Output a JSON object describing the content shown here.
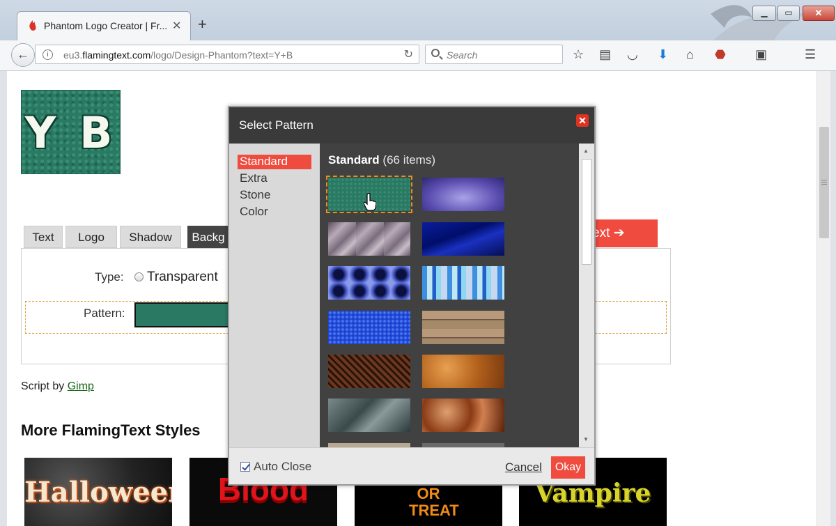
{
  "browser": {
    "tab_title": "Phantom Logo Creator | Fr...",
    "tab_close": "✕",
    "new_tab": "+",
    "url_prefix": "eu3.",
    "url_domain": "flamingtext.com",
    "url_path": "/logo/Design-Phantom?text=Y+B",
    "search_placeholder": "Search"
  },
  "page": {
    "logo_text": "Y B",
    "tabs": [
      "Text",
      "Logo",
      "Shadow",
      "Backg"
    ],
    "next_label": "ext ➔",
    "type_label": "Type:",
    "type_option": "Transparent",
    "pattern_label": "Pattern:",
    "script_by": "Script by",
    "script_by_link": "Gimp",
    "more_heading": "More FlamingText Styles",
    "thumbnails": [
      "Halloween",
      "Blood",
      "OR TREAT",
      "Vampire"
    ]
  },
  "modal": {
    "title": "Select Pattern",
    "categories": [
      "Standard",
      "Extra",
      "Stone",
      "Color"
    ],
    "active_category": "Standard",
    "grid_heading_name": "Standard",
    "grid_heading_count": "(66 items)",
    "auto_close_label": "Auto Close",
    "auto_close_checked": true,
    "cancel_label": "Cancel",
    "okay_label": "Okay"
  },
  "colors": {
    "accent": "#ef4b3f",
    "selected_pattern": "#2a7a63",
    "modal_header": "#3a3a3a"
  },
  "icons": [
    "back-arrow-icon",
    "info-icon",
    "reload-icon",
    "search-icon",
    "bookmark-star-icon",
    "reading-list-icon",
    "pocket-icon",
    "download-icon",
    "home-icon",
    "adblock-icon",
    "menu-icon",
    "close-icon"
  ]
}
